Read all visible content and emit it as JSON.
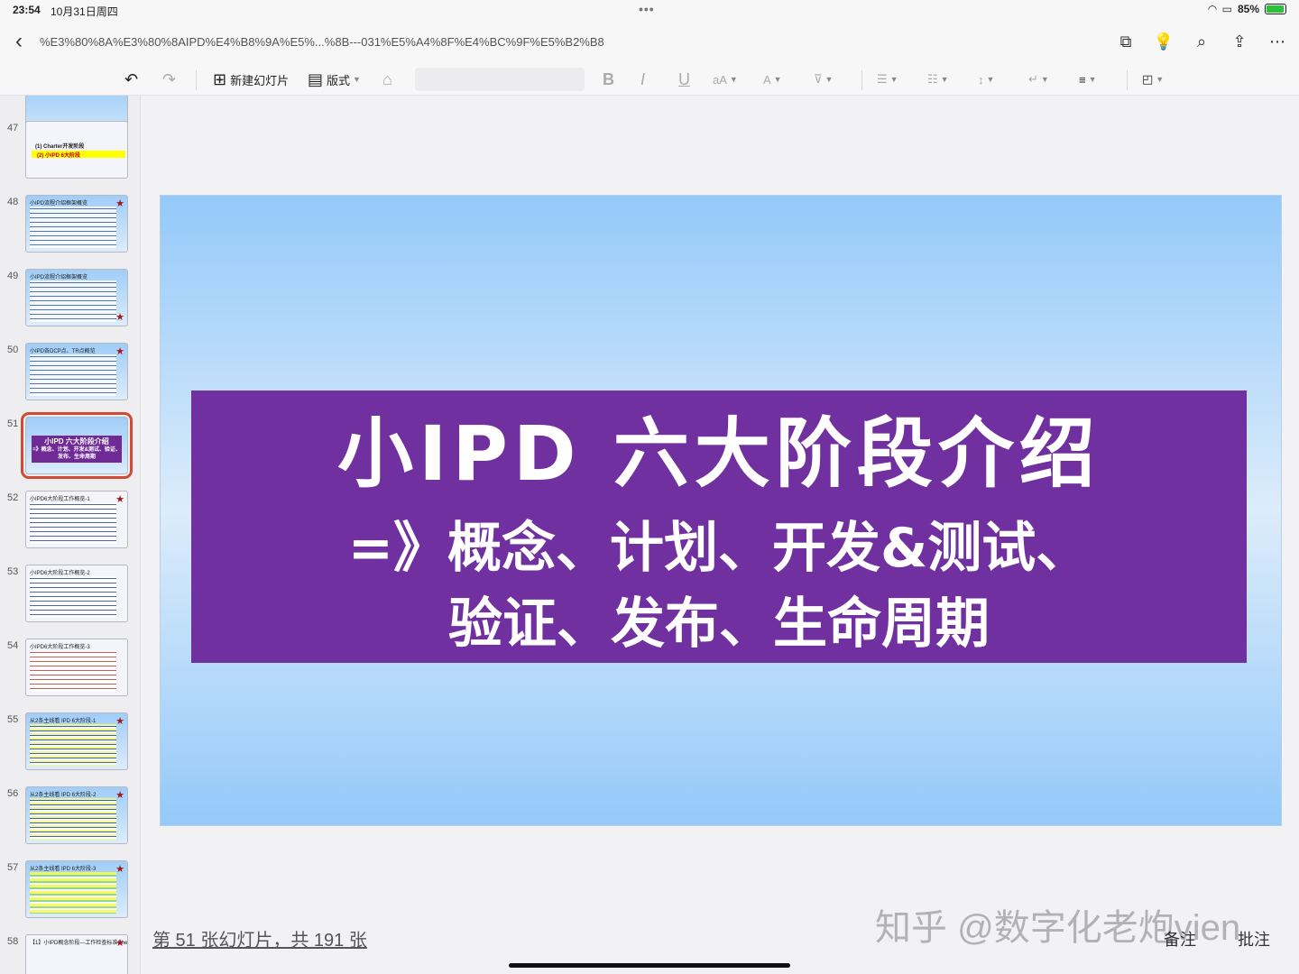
{
  "status": {
    "time": "23:54",
    "date": "10月31日周四",
    "battery": "85%",
    "battery_level": 0.85
  },
  "nav": {
    "title": "%E3%80%8A%E3%80%8AIPD%E4%B8%9A%E5%...%8B---031%E5%A4%8F%E4%BC%9F%E5%B2%B8"
  },
  "toolbar": {
    "new_slide": "新建幻灯片",
    "layout": "版式"
  },
  "thumbs": [
    {
      "num": "47",
      "line1": "(1) Charter开发阶段",
      "line2": "(2) 小IPD 6大阶段"
    },
    {
      "num": "48",
      "title": "小IPD流程介绍框架概览"
    },
    {
      "num": "49",
      "title": "小IPD流程介绍框架概览"
    },
    {
      "num": "50",
      "title": "小IPD各DCP点、TR点概览"
    },
    {
      "num": "51",
      "title": "小IPD 六大阶段介绍",
      "sub": "=》概念、计划、开发&测试、验证、发布、生命周期"
    },
    {
      "num": "52",
      "title": "小IPD6大阶段工作概览-1"
    },
    {
      "num": "53",
      "title": "小IPD6大阶段工作概览-2"
    },
    {
      "num": "54",
      "title": "小IPD6大阶段工作概览-3"
    },
    {
      "num": "55",
      "title": "从2条主线看 IPD 6大阶段-1"
    },
    {
      "num": "56",
      "title": "从2条主线看 IPD 6大阶段-2"
    },
    {
      "num": "57",
      "title": "从2条主线看 IPD 6大阶段-3"
    },
    {
      "num": "58",
      "title": "【1】小IPD概念阶段—工作检查标准Checklist"
    }
  ],
  "slide": {
    "line1": "小IPD 六大阶段介绍",
    "line2": "=》概念、计划、开发&测试、",
    "line3": "验证、发布、生命周期"
  },
  "footer": {
    "counter": "第 51 张幻灯片，共 191 张",
    "notes": "备注",
    "comments": "批注",
    "watermark": "知乎 @数字化老炮vien"
  }
}
